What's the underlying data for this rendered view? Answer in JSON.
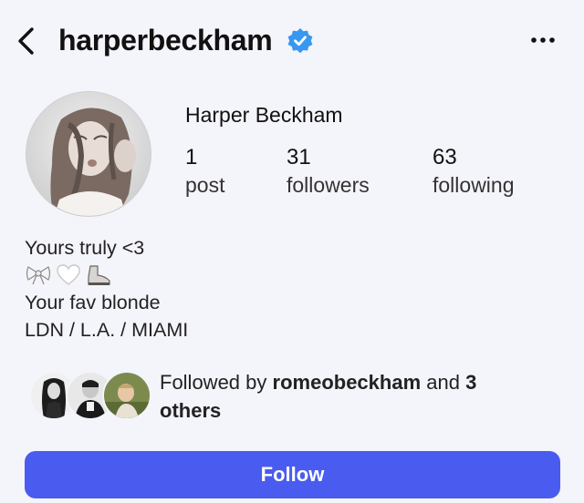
{
  "header": {
    "back_icon": "chevron-left-icon",
    "username": "harperbeckham",
    "verified_icon": "verified-badge-icon",
    "verified_color": "#3897f0",
    "more_icon": "more-horizontal-icon"
  },
  "profile": {
    "avatar_icon": "profile-photo",
    "full_name": "Harper Beckham",
    "stats": [
      {
        "count": "1",
        "label": "post"
      },
      {
        "count": "31",
        "label": "followers"
      },
      {
        "count": "63",
        "label": "following"
      }
    ]
  },
  "bio": {
    "line1": "Yours truly <3",
    "emojis": [
      "bow-emoji",
      "white-heart-emoji",
      "boot-emoji"
    ],
    "line2": "Your fav blonde",
    "line3": "LDN / L.A. / MIAMI"
  },
  "followed_by": {
    "prefix": "Followed by",
    "user": "romeobeckham",
    "middle": "and",
    "count": "3",
    "suffix": "others"
  },
  "actions": {
    "follow_label": "Follow",
    "follow_color": "#4a5bf0"
  }
}
